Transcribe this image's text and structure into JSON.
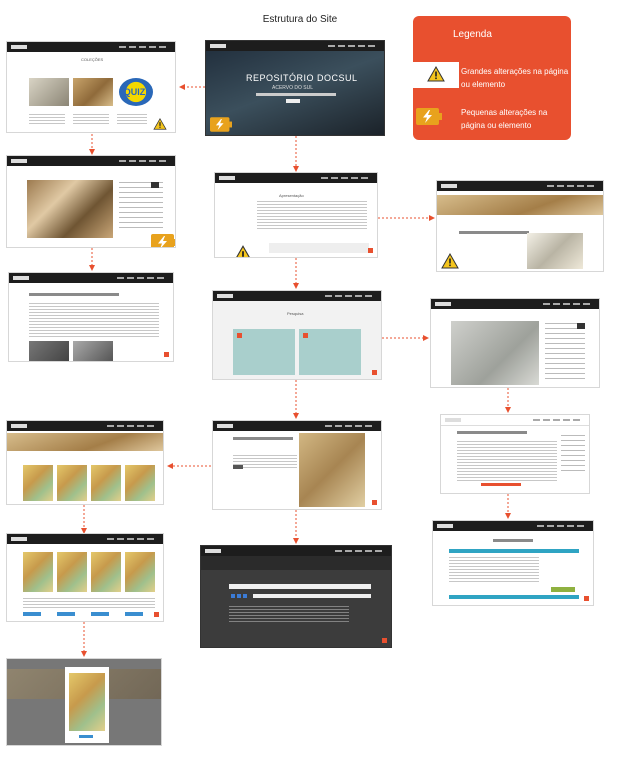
{
  "title": "Estrutura do Site",
  "legend": {
    "title": "Legenda",
    "major_label": "Grandes alterações na página ou elemento",
    "minor_label": "Pequenas alterações na página ou elemento",
    "colors": {
      "panel": "#e8502f",
      "warning": "#f4c51d",
      "bolt_box": "#e8a21d"
    }
  },
  "screens": {
    "home_banner": "REPOSITÓRIO DOCSUL",
    "home_sub": "ACERVO DO SUL",
    "collection_title": "COLEÇÕES",
    "quiz_badge": "QUIZ!",
    "pesquisa_title": "Pesquisa",
    "section_title": "Apresentação"
  },
  "colors": {
    "connector": "#e8502f"
  }
}
